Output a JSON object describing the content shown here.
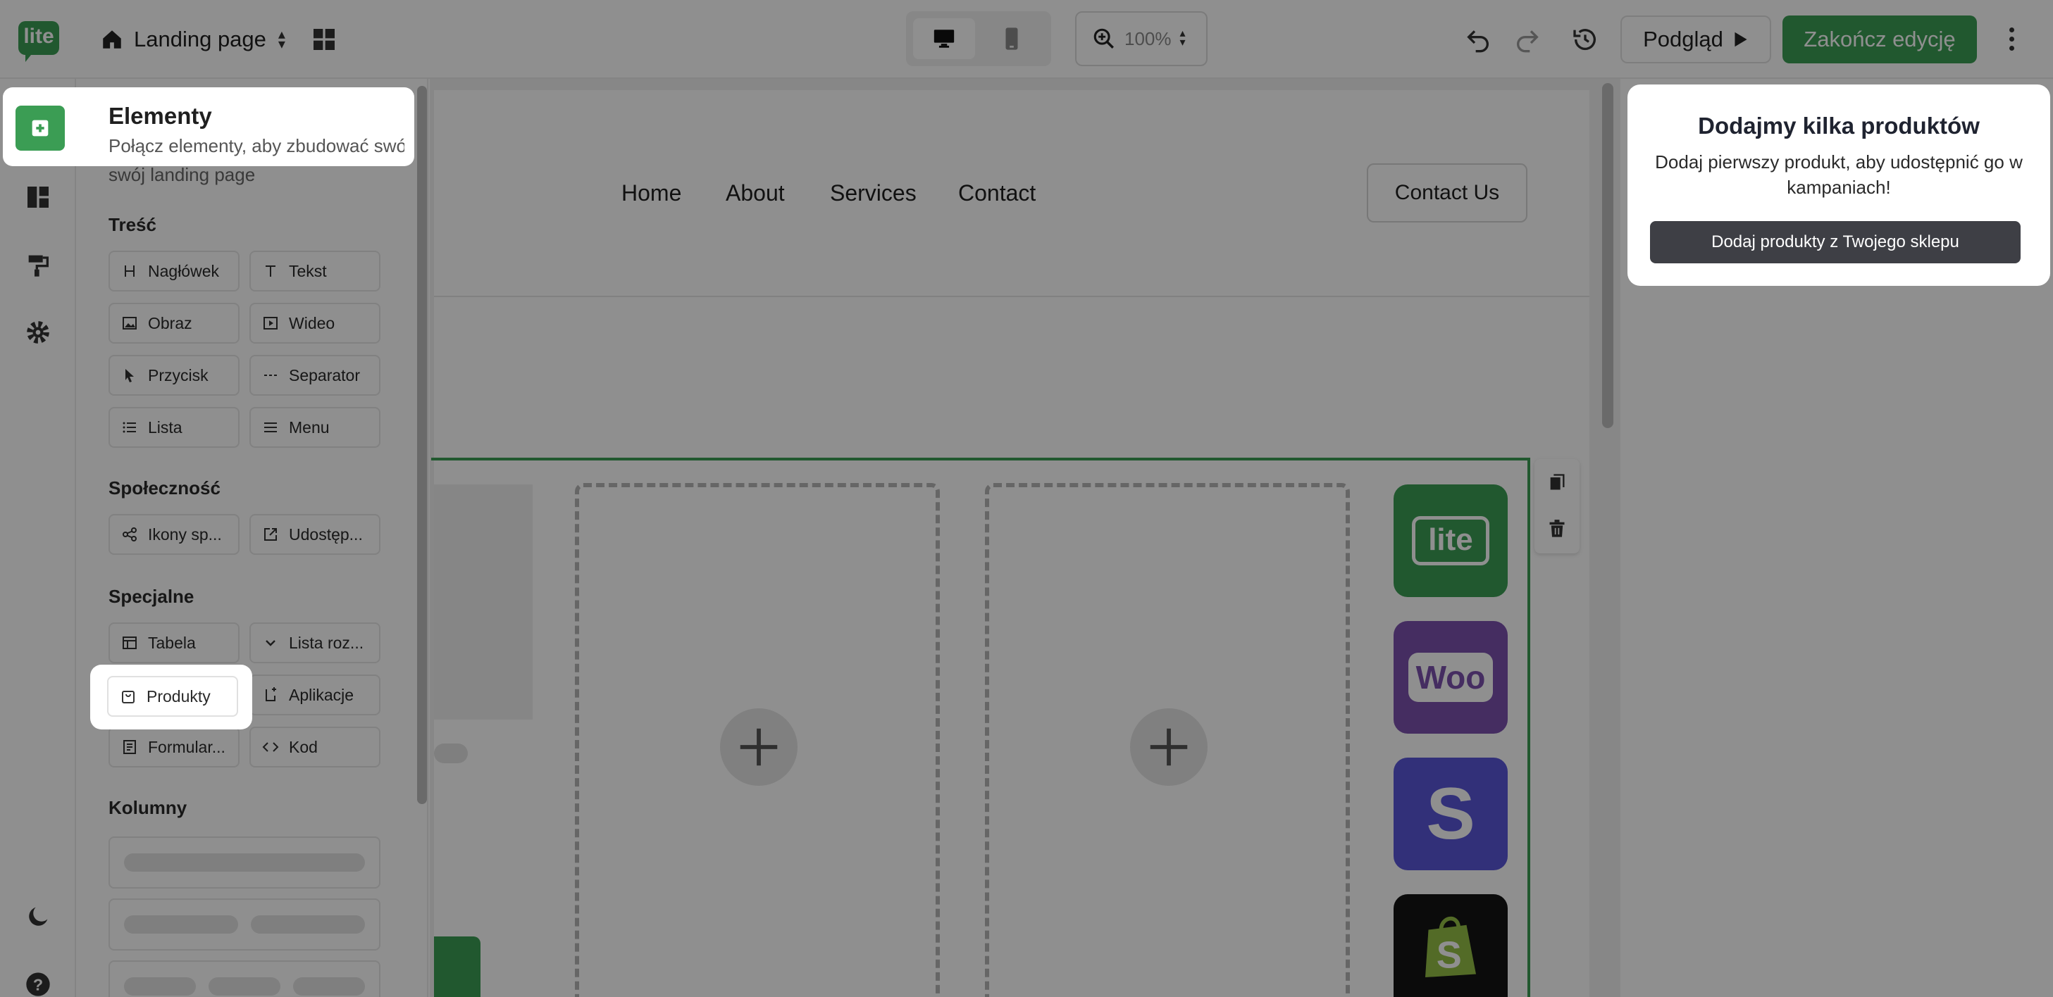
{
  "app": {
    "logo_text": "lite",
    "page_name": "Landing page",
    "zoom": "100%",
    "preview_label": "Podgląd",
    "finish_label": "Zakończ edycję"
  },
  "panel": {
    "title": "Elementy",
    "subtitle": "Połącz elementy, aby zbudować swój landing page",
    "sections": {
      "content": "Treść",
      "social": "Społeczność",
      "special": "Specjalne",
      "columns": "Kolumny"
    },
    "content_items": [
      "Nagłówek",
      "Tekst",
      "Obraz",
      "Wideo",
      "Przycisk",
      "Separator",
      "Lista",
      "Menu"
    ],
    "social_items": [
      "Ikony sp...",
      "Udostęp..."
    ],
    "special_items": [
      "Tabela",
      "Lista roz...",
      "Produkty",
      "Aplikacje",
      "Formular...",
      "Kod"
    ]
  },
  "canvas": {
    "nav": [
      "Home",
      "About",
      "Services",
      "Contact"
    ],
    "contact_button": "Contact Us",
    "apps": [
      "lite",
      "Woo",
      "S",
      "shopify"
    ]
  },
  "popup": {
    "title": "Dodajmy kilka produktów",
    "text": "Dodaj pierwszy produkt, aby udostępnić go w kampaniach!",
    "button": "Dodaj produkty z Twojego sklepu"
  },
  "colors": {
    "brand_green": "#3b9d54",
    "woo_purple": "#7b51ad",
    "stripe_indigo": "#5a56d8",
    "shopify_dark": "#141414",
    "overlay": "rgba(0,0,0,0.44)"
  }
}
